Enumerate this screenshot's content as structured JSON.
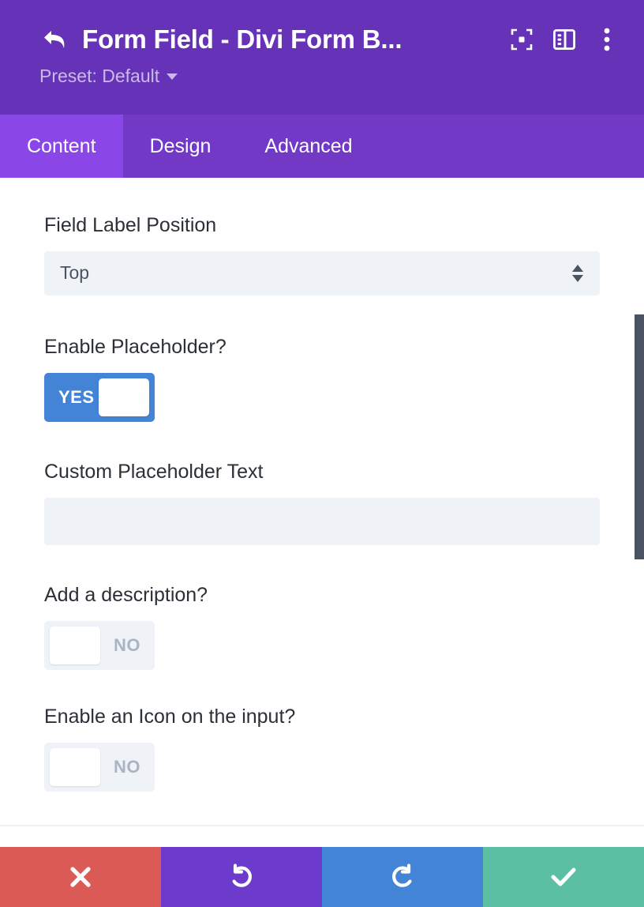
{
  "header": {
    "back_icon": "back-arrow-icon",
    "title": "Form Field - Divi Form B...",
    "icons": [
      {
        "name": "focus-target-icon"
      },
      {
        "name": "layout-panel-icon"
      },
      {
        "name": "more-vertical-icon"
      }
    ],
    "preset_label": "Preset: Default",
    "preset_caret_icon": "chevron-down-icon",
    "bg_color": "#6633b8"
  },
  "tabs": {
    "items": [
      {
        "label": "Content",
        "active": true
      },
      {
        "label": "Design",
        "active": false
      },
      {
        "label": "Advanced",
        "active": false
      }
    ],
    "active_bg": "#8b46e8",
    "bar_bg": "#7239c6"
  },
  "fields": {
    "field_label_position": {
      "label": "Field Label Position",
      "value": "Top",
      "arrows_icon": "sort-arrows-icon"
    },
    "enable_placeholder": {
      "label": "Enable Placeholder?",
      "state": "YES",
      "on": true,
      "on_color": "#4484d6"
    },
    "custom_placeholder_text": {
      "label": "Custom Placeholder Text",
      "value": "",
      "placeholder": ""
    },
    "add_description": {
      "label": "Add a description?",
      "state": "NO",
      "on": false,
      "off_color": "#eff2f7"
    },
    "enable_icon_on_input": {
      "label": "Enable an Icon on the input?",
      "state": "NO",
      "on": false,
      "off_color": "#eff2f7"
    }
  },
  "scrollbar": {
    "thumb_color": "#4a5362"
  },
  "bottom_bar": {
    "buttons": [
      {
        "name": "cancel-button",
        "icon": "close-x-icon",
        "color": "#db5a56"
      },
      {
        "name": "undo-button",
        "icon": "undo-icon",
        "color": "#6c3bcc"
      },
      {
        "name": "redo-button",
        "icon": "redo-icon",
        "color": "#4484d6"
      },
      {
        "name": "save-button",
        "icon": "checkmark-icon",
        "color": "#5bc0a3"
      }
    ]
  }
}
